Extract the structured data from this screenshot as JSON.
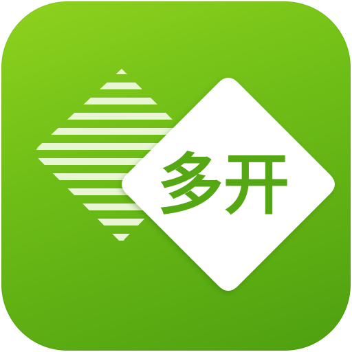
{
  "app_icon": {
    "logo_text": "多开",
    "colors": {
      "background_top": "#8fd21e",
      "background_bottom": "#4e9f10",
      "diamond": "#ffffff",
      "stripes": "#e8f6d4",
      "logo_text": "#56a714"
    }
  }
}
